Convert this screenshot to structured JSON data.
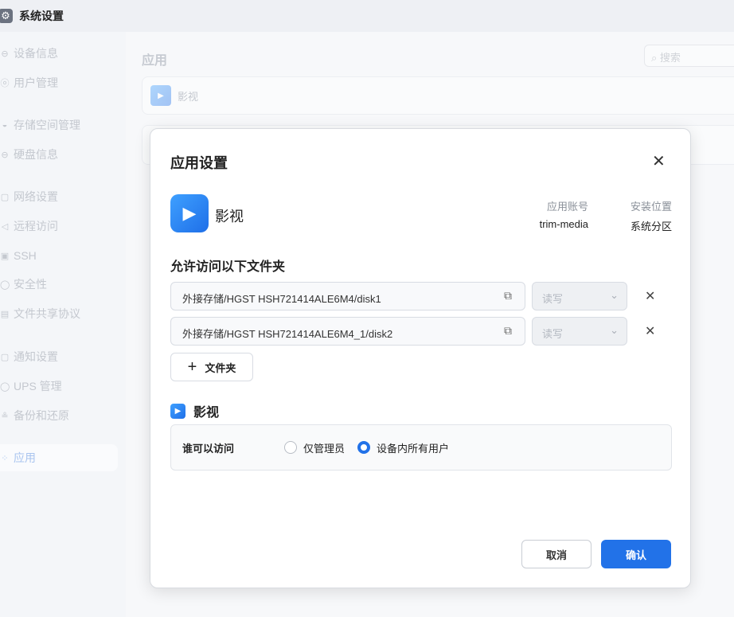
{
  "window": {
    "title": "系统设置"
  },
  "sidebar": {
    "items": [
      {
        "label": "设备信息",
        "icon": "⊖"
      },
      {
        "label": "用户管理",
        "icon": "ⓞ"
      },
      {
        "label": "存储空间管理",
        "icon": "◒"
      },
      {
        "label": "硬盘信息",
        "icon": "⊖"
      },
      {
        "label": "网络设置",
        "icon": "▢"
      },
      {
        "label": "远程访问",
        "icon": "◁"
      },
      {
        "label": "SSH",
        "icon": "▣"
      },
      {
        "label": "安全性",
        "icon": "◯"
      },
      {
        "label": "文件共享协议",
        "icon": "▤"
      },
      {
        "label": "通知设置",
        "icon": "▢"
      },
      {
        "label": "UPS 管理",
        "icon": "◯"
      },
      {
        "label": "备份和还原",
        "icon": "≗"
      },
      {
        "label": "应用",
        "icon": "⁘"
      }
    ]
  },
  "main": {
    "title": "应用",
    "search_placeholder": "搜索",
    "card_app": "影视"
  },
  "modal": {
    "title": "应用设置",
    "app_name": "影视",
    "account_label": "应用账号",
    "account_value": "trim-media",
    "location_label": "安装位置",
    "location_value": "系统分区",
    "folders_title": "允许访问以下文件夹",
    "folders": [
      {
        "path": "外接存储/HGST HSH721414ALE6M4/disk1",
        "permission": "读写"
      },
      {
        "path": "外接存储/HGST HSH721414ALE6M4_1/disk2",
        "permission": "读写"
      }
    ],
    "add_folder": "文件夹",
    "section_app": "影视",
    "access_label": "谁可以访问",
    "option_admin": "仅管理员",
    "option_all": "设备内所有用户",
    "selected": "设备内所有用户",
    "cancel": "取消",
    "confirm": "确认"
  },
  "colors": {
    "accent": "#2272e8"
  }
}
